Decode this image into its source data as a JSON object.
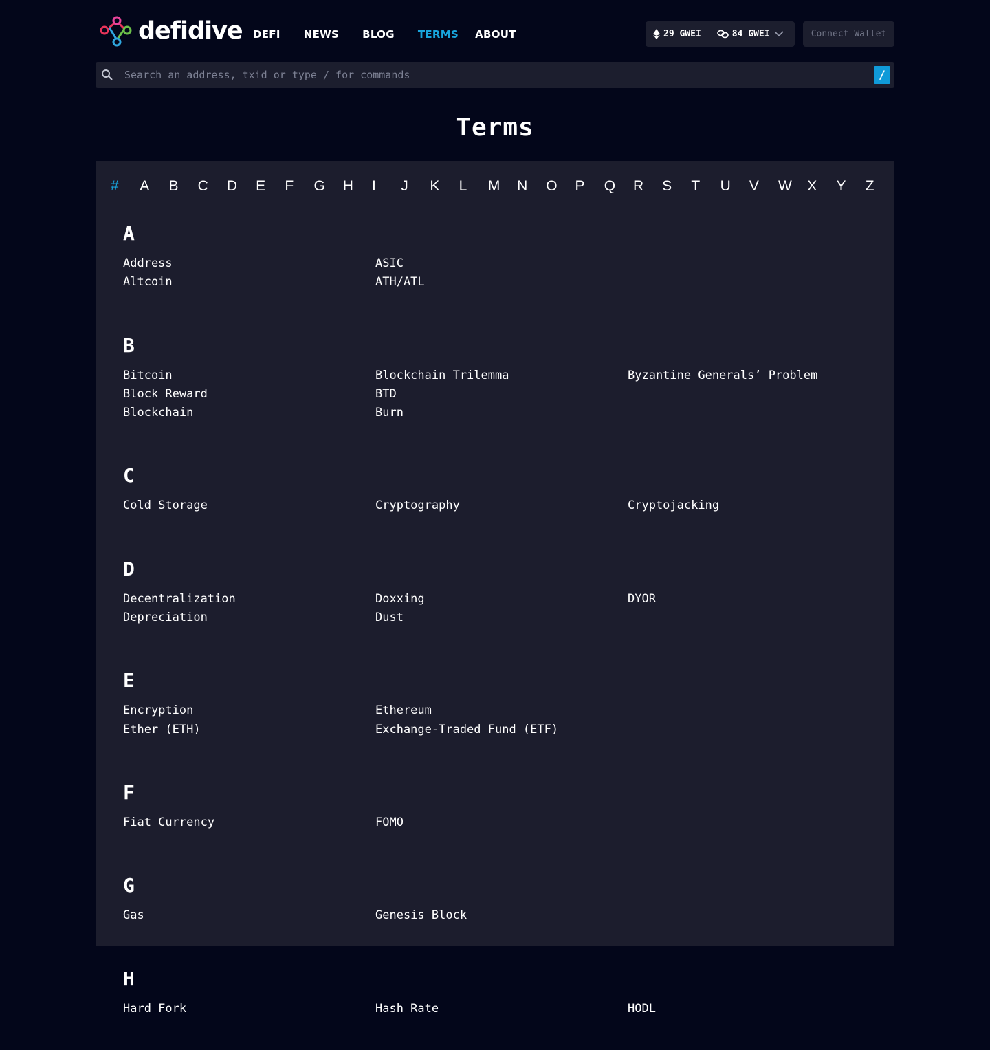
{
  "brand": {
    "name": "defidive"
  },
  "nav": [
    {
      "label": "DEFI",
      "active": false
    },
    {
      "label": "NEWS",
      "active": false
    },
    {
      "label": "BLOG",
      "active": false
    },
    {
      "label": "TERMS",
      "active": true
    },
    {
      "label": "ABOUT",
      "active": false
    }
  ],
  "gas": {
    "eth": "29 GWEI",
    "chain": "84 GWEI"
  },
  "connect_label": "Connect Wallet",
  "search": {
    "placeholder": "Search an address, txid or type / for commands",
    "shortcut": "/"
  },
  "page_title": "Terms",
  "alphabet": [
    "#",
    "A",
    "B",
    "C",
    "D",
    "E",
    "F",
    "G",
    "H",
    "I",
    "J",
    "K",
    "L",
    "M",
    "N",
    "O",
    "P",
    "Q",
    "R",
    "S",
    "T",
    "U",
    "V",
    "W",
    "X",
    "Y",
    "Z"
  ],
  "active_letter": "#",
  "colors": {
    "accent": "#18a4dc",
    "background": "#03061a",
    "panel": "#1c1d2d"
  },
  "sections": [
    {
      "letter": "A",
      "rows": 2,
      "terms": [
        "Address",
        "Altcoin",
        "ASIC",
        "ATH/ATL"
      ]
    },
    {
      "letter": "B",
      "rows": 3,
      "terms": [
        "Bitcoin",
        "Block Reward",
        "Blockchain",
        "Blockchain Trilemma",
        "BTD",
        "Burn",
        "Byzantine Generals’ Problem"
      ]
    },
    {
      "letter": "C",
      "rows": 1,
      "terms": [
        "Cold Storage",
        "Cryptography",
        "Cryptojacking"
      ]
    },
    {
      "letter": "D",
      "rows": 2,
      "terms": [
        "Decentralization",
        "Depreciation",
        "Doxxing",
        "Dust",
        "DYOR"
      ]
    },
    {
      "letter": "E",
      "rows": 2,
      "terms": [
        "Encryption",
        "Ether (ETH)",
        "Ethereum",
        "Exchange-Traded Fund (ETF)"
      ]
    },
    {
      "letter": "F",
      "rows": 1,
      "terms": [
        "Fiat Currency",
        "FOMO"
      ]
    },
    {
      "letter": "G",
      "rows": 1,
      "terms": [
        "Gas",
        "Genesis Block"
      ]
    },
    {
      "letter": "H",
      "rows": 1,
      "terms": [
        "Hard Fork",
        "Hash Rate",
        "HODL"
      ]
    }
  ]
}
